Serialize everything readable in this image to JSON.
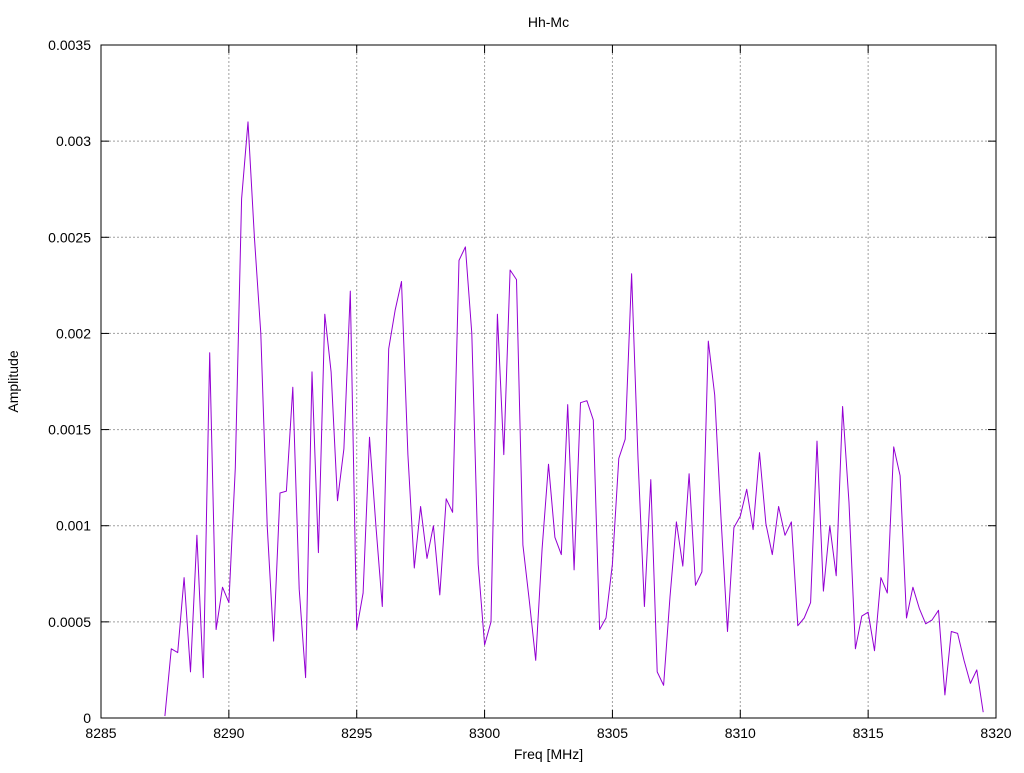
{
  "chart_data": {
    "type": "line",
    "title": "Hh-Mc",
    "xlabel": "Freq [MHz]",
    "ylabel": "Amplitude",
    "xlim": [
      8285,
      8320
    ],
    "ylim": [
      0,
      0.0035
    ],
    "xticks": [
      8285,
      8290,
      8295,
      8300,
      8305,
      8310,
      8315,
      8320
    ],
    "xtick_labels": [
      "8285",
      "8290",
      "8295",
      "8300",
      "8305",
      "8310",
      "8315",
      "8320"
    ],
    "yticks": [
      0,
      0.0005,
      0.001,
      0.0015,
      0.002,
      0.0025,
      0.003,
      0.0035
    ],
    "ytick_labels": [
      "0",
      "0.0005",
      "0.001",
      "0.0015",
      "0.002",
      "0.0025",
      "0.003",
      "0.0035"
    ],
    "grid": true,
    "series": [
      {
        "color": "#9400D3",
        "x": [
          8287.5,
          8287.75,
          8288.0,
          8288.25,
          8288.5,
          8288.75,
          8289.0,
          8289.25,
          8289.5,
          8289.75,
          8290.0,
          8290.25,
          8290.5,
          8290.75,
          8291.0,
          8291.25,
          8291.5,
          8291.75,
          8292.0,
          8292.25,
          8292.5,
          8292.75,
          8293.0,
          8293.25,
          8293.5,
          8293.75,
          8294.0,
          8294.25,
          8294.5,
          8294.75,
          8295.0,
          8295.25,
          8295.5,
          8295.75,
          8296.0,
          8296.25,
          8296.5,
          8296.75,
          8297.0,
          8297.25,
          8297.5,
          8297.75,
          8298.0,
          8298.25,
          8298.5,
          8298.75,
          8299.0,
          8299.25,
          8299.5,
          8299.75,
          8300.0,
          8300.25,
          8300.5,
          8300.75,
          8301.0,
          8301.25,
          8301.5,
          8301.75,
          8302.0,
          8302.25,
          8302.5,
          8302.75,
          8303.0,
          8303.25,
          8303.5,
          8303.75,
          8304.0,
          8304.25,
          8304.5,
          8304.75,
          8305.0,
          8305.25,
          8305.5,
          8305.75,
          8306.0,
          8306.25,
          8306.5,
          8306.75,
          8307.0,
          8307.25,
          8307.5,
          8307.75,
          8308.0,
          8308.25,
          8308.5,
          8308.75,
          8309.0,
          8309.25,
          8309.5,
          8309.75,
          8310.0,
          8310.25,
          8310.5,
          8310.75,
          8311.0,
          8311.25,
          8311.5,
          8311.75,
          8312.0,
          8312.25,
          8312.5,
          8312.75,
          8313.0,
          8313.25,
          8313.5,
          8313.75,
          8314.0,
          8314.25,
          8314.5,
          8314.75,
          8315.0,
          8315.25,
          8315.5,
          8315.75,
          8316.0,
          8316.25,
          8316.5,
          8316.75,
          8317.0,
          8317.25,
          8317.5,
          8317.75,
          8318.0,
          8318.25,
          8318.5,
          8318.75,
          8319.0,
          8319.25,
          8319.5
        ],
        "y": [
          1e-05,
          0.00036,
          0.00034,
          0.00073,
          0.00024,
          0.00095,
          0.00021,
          0.0019,
          0.00046,
          0.00068,
          0.0006,
          0.0013,
          0.0027,
          0.0031,
          0.0025,
          0.002,
          0.001,
          0.0004,
          0.00117,
          0.00118,
          0.00172,
          0.00067,
          0.00021,
          0.0018,
          0.00086,
          0.0021,
          0.0018,
          0.00113,
          0.0014,
          0.00222,
          0.00046,
          0.00065,
          0.00146,
          0.001,
          0.00058,
          0.00192,
          0.00212,
          0.00227,
          0.00137,
          0.00078,
          0.0011,
          0.00083,
          0.001,
          0.00064,
          0.00114,
          0.00107,
          0.00238,
          0.00245,
          0.002,
          0.0008,
          0.00038,
          0.0005,
          0.0021,
          0.00137,
          0.00233,
          0.00228,
          0.0009,
          0.00061,
          0.0003,
          0.00088,
          0.00132,
          0.00094,
          0.00085,
          0.00163,
          0.00077,
          0.00164,
          0.00165,
          0.00155,
          0.00046,
          0.00052,
          0.0008,
          0.00135,
          0.00145,
          0.00231,
          0.00135,
          0.00058,
          0.00124,
          0.00024,
          0.00017,
          0.00063,
          0.00102,
          0.00079,
          0.00127,
          0.00069,
          0.00076,
          0.00196,
          0.00168,
          0.00103,
          0.00045,
          0.00099,
          0.00105,
          0.00119,
          0.00098,
          0.00138,
          0.00101,
          0.00085,
          0.0011,
          0.00095,
          0.00102,
          0.00048,
          0.00052,
          0.0006,
          0.00144,
          0.00066,
          0.001,
          0.00074,
          0.00162,
          0.00112,
          0.00036,
          0.00053,
          0.00055,
          0.00035,
          0.00073,
          0.00065,
          0.00141,
          0.00126,
          0.00052,
          0.00068,
          0.00057,
          0.00049,
          0.00051,
          0.00056,
          0.00012,
          0.00045,
          0.00044,
          0.0003,
          0.00018,
          0.00025,
          3e-05
        ]
      }
    ]
  }
}
